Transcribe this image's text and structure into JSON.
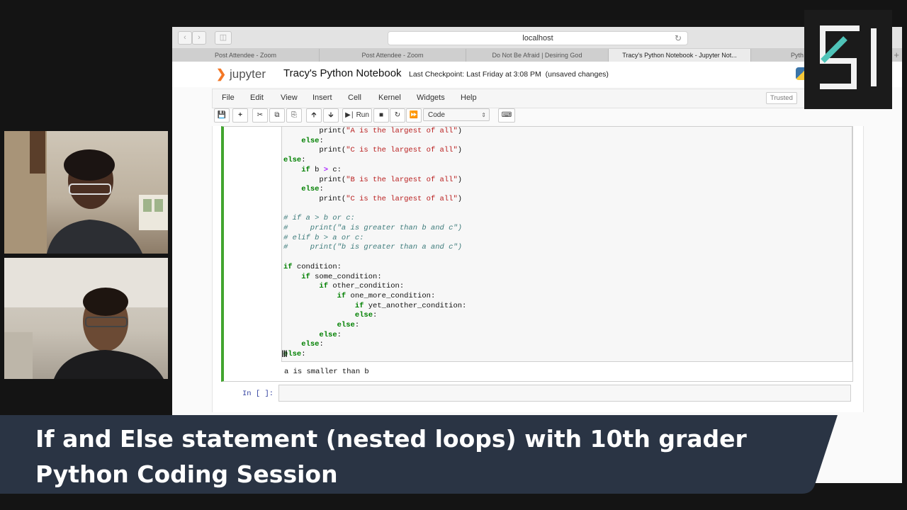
{
  "browser": {
    "address": "localhost",
    "tabs": [
      {
        "label": "Post Attendee - Zoom"
      },
      {
        "label": "Post Attendee - Zoom"
      },
      {
        "label": "Do Not Be Afraid | Desiring God"
      },
      {
        "label": "Tracy's Python Notebook - Jupyter Not..."
      },
      {
        "label": "Pyth"
      }
    ],
    "active_tab": 3
  },
  "jupyter": {
    "logo_text": "jupyter",
    "notebook_title": "Tracy's Python Notebook",
    "checkpoint": "Last Checkpoint: Last Friday at 3:08 PM",
    "unsaved": "(unsaved changes)",
    "menu": [
      "File",
      "Edit",
      "View",
      "Insert",
      "Cell",
      "Kernel",
      "Widgets",
      "Help"
    ],
    "trusted": "Trusted",
    "run_label": "Run",
    "cell_type": "Code"
  },
  "cell": {
    "output": "a is smaller than b",
    "next_prompt": "In [ ]:"
  },
  "caption": {
    "line1": "If and Else statement (nested loops) with 10th grader",
    "line2": "Python Coding Session"
  },
  "colors": {
    "cell_selected_border": "#42a52f",
    "banner_bg": "#2a3444",
    "badge_accent": "#4fc3b8"
  }
}
